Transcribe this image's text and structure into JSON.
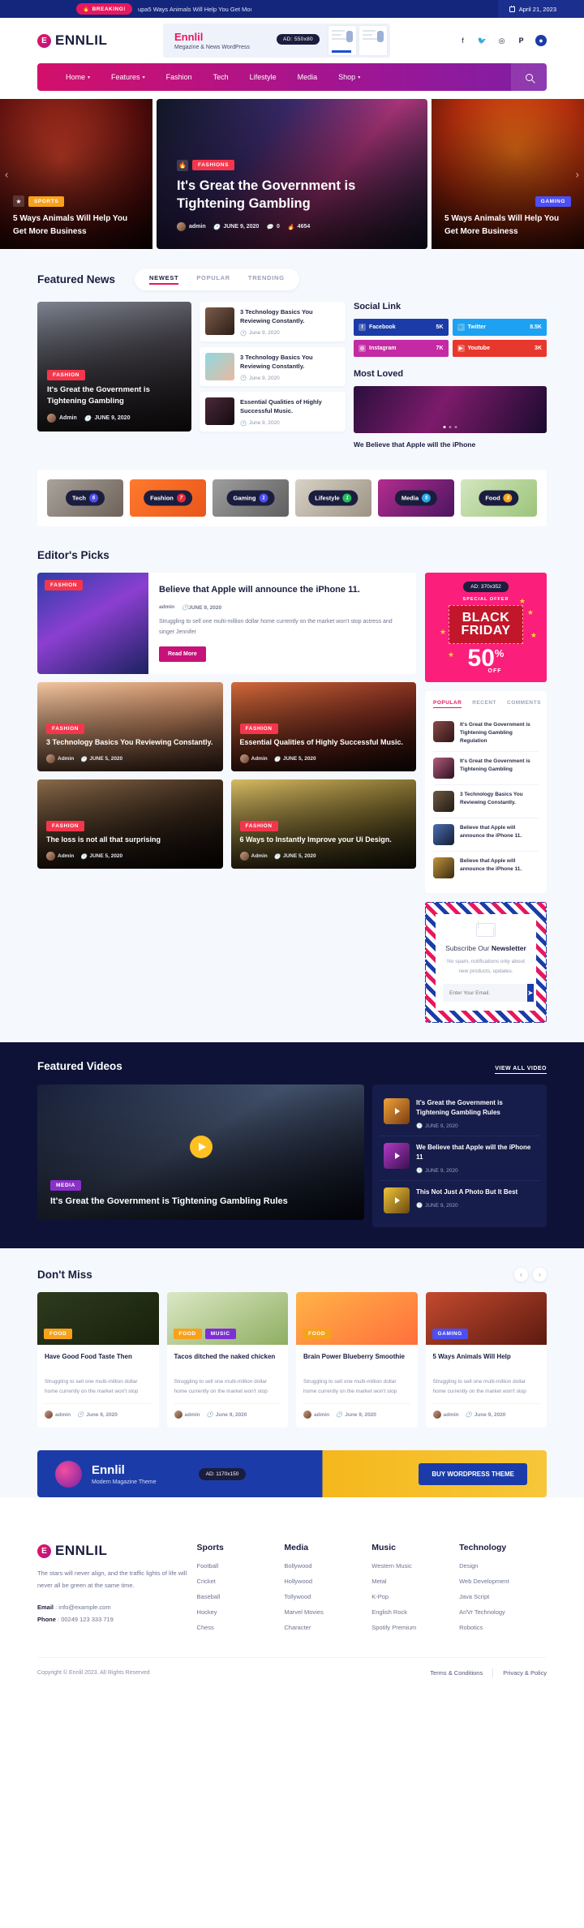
{
  "topbar": {
    "breaking_label": "BREAKING!",
    "breaking_icon": "fire-icon",
    "breaking_text": "upa5 Ways Animals Will Help You Get Moı",
    "date": "April 21, 2023"
  },
  "header": {
    "logo": "ENNLIL",
    "ad": {
      "title": "Ennlil",
      "subtitle": "Megazine & News WordPress",
      "chip": "AD: 550x80"
    },
    "socials": [
      "facebook-icon",
      "twitter-icon",
      "instagram-icon",
      "pinterest-icon",
      "more-icon"
    ]
  },
  "nav": {
    "items": [
      {
        "label": "Home",
        "caret": true
      },
      {
        "label": "Features",
        "caret": true
      },
      {
        "label": "Fashion",
        "caret": false
      },
      {
        "label": "Tech",
        "caret": false
      },
      {
        "label": "Lifestyle",
        "caret": false
      },
      {
        "label": "Media",
        "caret": false
      },
      {
        "label": "Shop",
        "caret": true
      }
    ],
    "search_icon": "search-icon"
  },
  "hero": {
    "left": {
      "tag": "SPORTS",
      "title": "5 Ways Animals Will Help You Get More Business"
    },
    "main": {
      "tag": "FASHIONS",
      "title": "It's Great the Government is Tightening Gambling",
      "author": "admin",
      "date": "JUNE 9, 2020",
      "comments": "0",
      "views": "4654"
    },
    "right": {
      "tag": "GAMING",
      "title": "5 Ways Animals Will Help You Get More Business"
    }
  },
  "featured_news": {
    "title": "Featured News",
    "tabs": [
      "NEWEST",
      "POPULAR",
      "TRENDING"
    ],
    "active_tab": "NEWEST",
    "main_card": {
      "tag": "FASHION",
      "title": "It's Great the Government is Tightening Gambling",
      "author": "Admin",
      "date": "JUNE 9, 2020"
    },
    "list": [
      {
        "title": "3 Technology Basics You Reviewing Constantly.",
        "date": "June 9, 2020"
      },
      {
        "title": "3 Technology Basics You Reviewing Constantly.",
        "date": "June 9, 2020"
      },
      {
        "title": "Essential Qualities of Highly Successful Music.",
        "date": "June 9, 2020"
      }
    ]
  },
  "social_link": {
    "title": "Social Link",
    "items": [
      {
        "name": "Facebook",
        "count": "5K",
        "color": "#1b3ca8",
        "icon": "facebook-icon"
      },
      {
        "name": "Twitter",
        "count": "8.5K",
        "color": "#1da1f2",
        "icon": "twitter-icon"
      },
      {
        "name": "Instagram",
        "count": "7K",
        "color": "#c32aa3",
        "icon": "instagram-icon"
      },
      {
        "name": "Youtube",
        "count": "3K",
        "color": "#e8372c",
        "icon": "youtube-icon"
      }
    ]
  },
  "most_loved": {
    "title": "Most Loved",
    "caption": "We Believe that Apple will the iPhone"
  },
  "categories": [
    {
      "label": "Tech",
      "count": "6",
      "color": "#4b4ff5"
    },
    {
      "label": "Fashion",
      "count": "7",
      "color": "#e8283c"
    },
    {
      "label": "Gaming",
      "count": "1",
      "color": "#4b4ff5"
    },
    {
      "label": "Lifestyle",
      "count": "1",
      "color": "#1fbf5b"
    },
    {
      "label": "Media",
      "count": "5",
      "color": "#2aa7e8"
    },
    {
      "label": "Food",
      "count": "3",
      "color": "#f7a21b"
    }
  ],
  "editors_picks": {
    "title": "Editor's Picks",
    "hero": {
      "tag": "FASHION",
      "title": "Believe that Apple will announce the iPhone 11.",
      "author": "admin",
      "date": "JUNE 9, 2020",
      "excerpt": "Struggling to sell one multi-million dollar home currently on the market won't stop actress and singer Jennifer",
      "button": "Read More"
    },
    "cards": [
      {
        "tag": "FASHION",
        "title": "3 Technology Basics You Reviewing Constantly.",
        "author": "Admin",
        "date": "JUNE 5, 2020"
      },
      {
        "tag": "FASHION",
        "title": "Essential Qualities of Highly Successful Music.",
        "author": "Admin",
        "date": "JUNE 5, 2020"
      },
      {
        "tag": "FASHION",
        "title": "The loss is not all that surprising",
        "author": "Admin",
        "date": "JUNE 5, 2020"
      },
      {
        "tag": "FASHION",
        "title": "6 Ways to Instantly Improve your Ui Design.",
        "author": "Admin",
        "date": "JUNE 5, 2020"
      }
    ]
  },
  "ad_sidebar": {
    "chip": "AD: 370x352",
    "special": "SPECIAL OFFER",
    "line1": "BLACK",
    "line2": "FRIDAY",
    "discount": "50",
    "percent": "%",
    "off": "OFF"
  },
  "popular_widget": {
    "tabs": [
      "POPULAR",
      "RECENT",
      "COMMENTS"
    ],
    "active_tab": "POPULAR",
    "items": [
      "It's Great the Government is Tightening Gambling Regulation",
      "It's Great the Government is Tightening Gambling",
      "3 Technology Basics You Reviewing Constantly.",
      "Believe that Apple will announce the iPhone 11.",
      "Believe that Apple will announce the iPhone 11."
    ]
  },
  "newsletter": {
    "title_light": "Subscribe Our ",
    "title_bold": "Newsletter",
    "desc": "No spam, notifications only about new products, updates.",
    "placeholder": "Enter Your Email.",
    "submit_icon": "send-icon"
  },
  "featured_videos": {
    "title": "Featured Videos",
    "view_all": "VIEW ALL VIDEO",
    "main": {
      "tag": "MEDIA",
      "title": "It's Great the Government is Tightening Gambling Rules",
      "play_icon": "play-icon"
    },
    "list": [
      {
        "title": "It's Great the Government is Tightening Gambling Rules",
        "date": "JUNE 9, 2020"
      },
      {
        "title": "We Believe that Apple will the iPhone 11",
        "date": "JUNE 9, 2020"
      },
      {
        "title": "This Not Just A Photo But It Best",
        "date": "JUNE 9, 2020"
      }
    ]
  },
  "dont_miss": {
    "title": "Don't Miss",
    "prev_icon": "chevron-left-icon",
    "next_icon": "chevron-right-icon",
    "cards": [
      {
        "tags": [
          {
            "label": "FOOD",
            "cls": "food"
          }
        ],
        "title": "Have Good Food Taste Then",
        "excerpt": "Struggling to sell one multi-million dollar home currently on the market won't stop",
        "author": "admin",
        "date": "June 9, 2020"
      },
      {
        "tags": [
          {
            "label": "FOOD",
            "cls": "food"
          },
          {
            "label": "MUSIC",
            "cls": "music"
          }
        ],
        "title": "Tacos ditched the naked chicken",
        "excerpt": "Struggling to sell one multi-million dollar home currently on the market won't stop",
        "author": "admin",
        "date": "June 9, 2020"
      },
      {
        "tags": [
          {
            "label": "FOOD",
            "cls": "food"
          }
        ],
        "title": "Brain Power Blueberry Smoothie",
        "excerpt": "Struggling to sell one multi-million dollar home currently on the market won't stop",
        "author": "admin",
        "date": "June 9, 2020"
      },
      {
        "tags": [
          {
            "label": "GAMING",
            "cls": "gaming"
          }
        ],
        "title": "5 Ways Animals Will Help",
        "excerpt": "Struggling to sell one multi-million dollar home currently on the market won't stop",
        "author": "admin",
        "date": "June 9, 2020"
      }
    ]
  },
  "promo": {
    "title": "Ennlil",
    "subtitle": "Modern Magazine Theme",
    "chip": "AD: 1170x150",
    "button": "BUY WORDPRESS THEME"
  },
  "footer": {
    "logo": "ENNLIL",
    "about": "The stars will never align, and the traffic lights of life will never all be green at the same time.",
    "email_label": "Email",
    "email": "info@example.com",
    "phone_label": "Phone",
    "phone": "00249 123 333 719",
    "columns": [
      {
        "title": "Sports",
        "links": [
          "Football",
          "Cricket",
          "Baseball",
          "Hockey",
          "Chess"
        ]
      },
      {
        "title": "Media",
        "links": [
          "Bollywood",
          "Hollywood",
          "Tollywood",
          "Marvel Movies",
          "Character"
        ]
      },
      {
        "title": "Music",
        "links": [
          "Western Music",
          "Metal",
          "K-Pop",
          "English Rock",
          "Spotify Premium"
        ]
      },
      {
        "title": "Technology",
        "links": [
          "Design",
          "Web Development",
          "Java Script",
          "Ar/Vr Technology",
          "Robotics"
        ]
      }
    ],
    "copyright": "Copyright © Ennlil 2023. All Rights Reserved",
    "terms": "Terms & Conditions",
    "privacy": "Privacy & Policy"
  }
}
